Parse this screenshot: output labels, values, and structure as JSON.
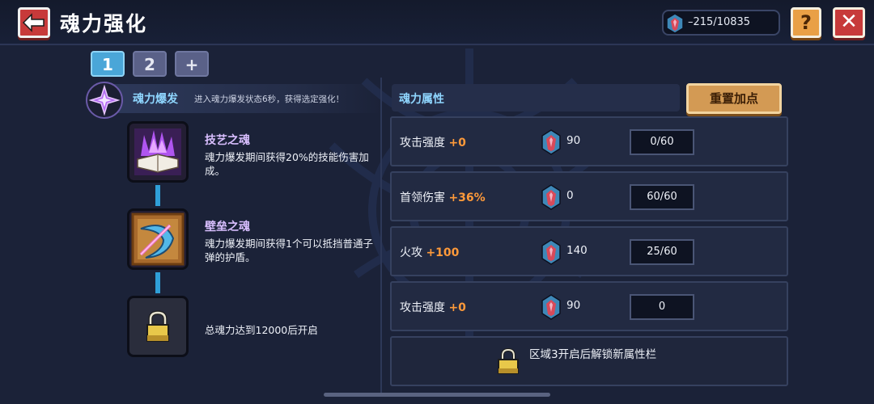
{
  "header": {
    "title": "魂力强化",
    "currency": "–215/10835",
    "help_label": "?",
    "close_label": "✕"
  },
  "tabs": [
    {
      "label": "1",
      "active": true
    },
    {
      "label": "2",
      "active": false
    },
    {
      "label": "+",
      "active": false
    }
  ],
  "burst": {
    "title": "魂力爆发",
    "description": "进入魂力爆发状态6秒，获得选定强化！"
  },
  "skills": [
    {
      "name": "技艺之魂",
      "description": "魂力爆发期间获得20%的技能伤害加成。",
      "icon": "purple-crystal-book-icon"
    },
    {
      "name": "壁垒之魂",
      "description": "魂力爆发期间获得1个可以抵挡普通子弹的护盾。",
      "icon": "shield-arc-icon"
    },
    {
      "name": "",
      "description": "总魂力达到12000后开启",
      "icon": "padlock-icon"
    }
  ],
  "attributes": {
    "title": "魂力属性",
    "reset_label": "重置加点",
    "rows": [
      {
        "label": "攻击强度",
        "bonus": "+0",
        "cost": "90",
        "progress": "0/60"
      },
      {
        "label": "首领伤害",
        "bonus": "+36%",
        "cost": "0",
        "progress": "60/60"
      },
      {
        "label": "火攻",
        "bonus": "+100",
        "cost": "140",
        "progress": "25/60"
      },
      {
        "label": "攻击强度",
        "bonus": "+0",
        "cost": "90",
        "progress": "0"
      }
    ],
    "locked_text": "区域3开启后解锁新属性栏"
  },
  "colors": {
    "background": "#1b2238",
    "accent_blue": "#4aa6d8",
    "bonus_orange": "#ff9a3a",
    "danger_red": "#c73a3a",
    "gold": "#d39a54"
  }
}
